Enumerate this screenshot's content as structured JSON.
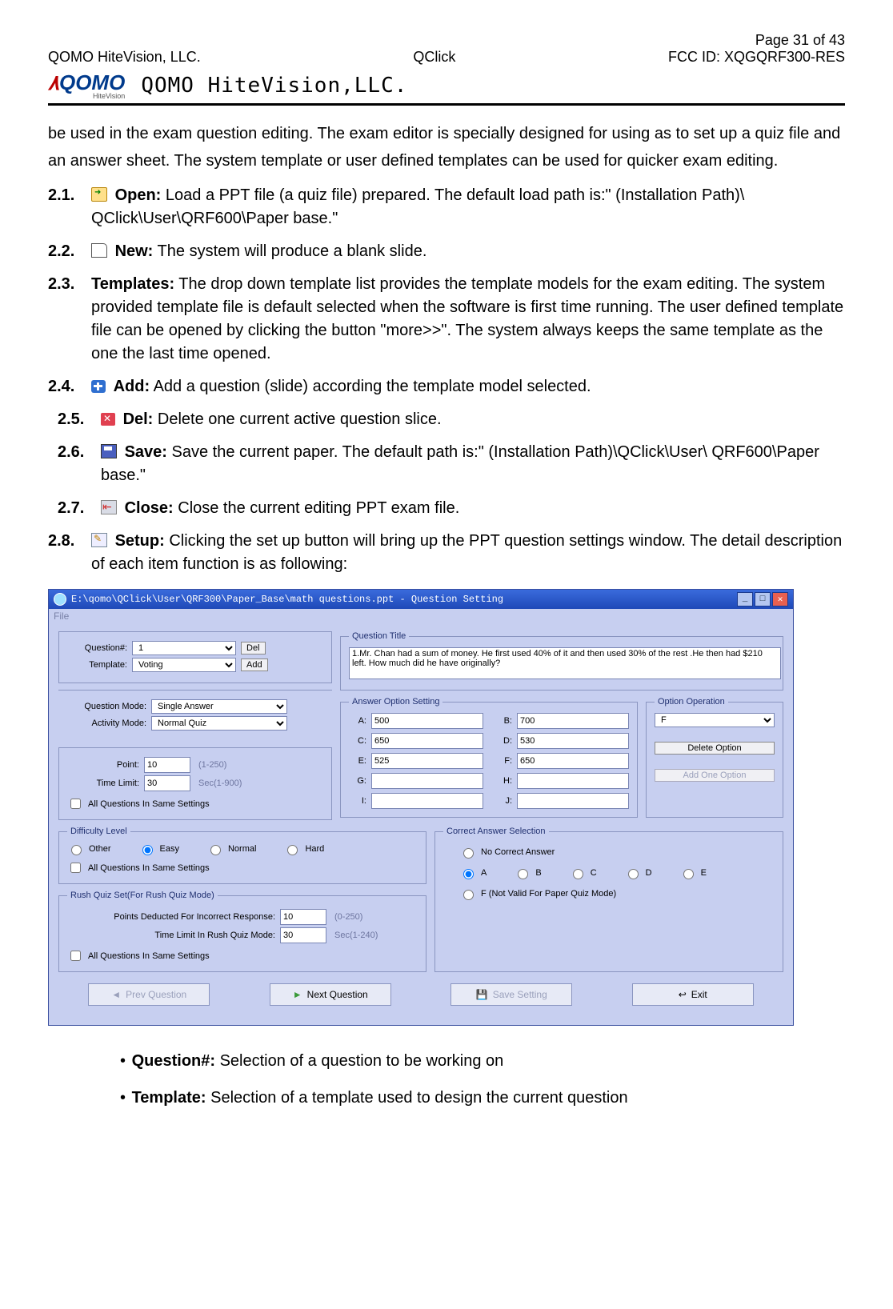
{
  "header": {
    "pageNum": "Page 31 of 43",
    "left": "QOMO HiteVision, LLC.",
    "center": "QClick",
    "right": "FCC ID: XQGQRF300-RES",
    "logo": "QOMO",
    "logoSub": "QOMO HiteVision,LLC."
  },
  "intro": "be used in the exam question editing. The exam editor is specially designed for using as to set up a quiz file and an answer sheet. The system template or user defined templates can be used for quicker exam editing.",
  "items": [
    {
      "num": "2.1.",
      "icon": "open",
      "label": "Open:",
      "text": " Load a PPT file (a quiz file) prepared. The default load path is:\" (Installation Path)\\ QClick\\User\\QRF600\\Paper base.\""
    },
    {
      "num": "2.2.",
      "icon": "new",
      "label": "New:",
      "text": " The system will produce a blank slide."
    },
    {
      "num": "2.3.",
      "icon": "",
      "label": "Templates:",
      "text": " The drop down template list provides the template models for the exam editing. The system provided template file is default selected when the software is first time running. The user defined template file can be opened by clicking the button \"more>>\". The system always keeps the same template as the one the last time opened."
    },
    {
      "num": "2.4.",
      "icon": "add",
      "label": "Add:",
      "text": " Add a question (slide) according the template model selected."
    },
    {
      "num": "2.5.",
      "icon": "del",
      "label": "Del:",
      "text": " Delete one current active question slice."
    },
    {
      "num": "2.6.",
      "icon": "save",
      "label": "Save:",
      "text": " Save the current paper. The default path is:\" (Installation Path)\\QClick\\User\\ QRF600\\Paper base.\""
    },
    {
      "num": "2.7.",
      "icon": "close",
      "label": "Close:",
      "text": " Close the current editing PPT exam file."
    },
    {
      "num": "2.8.",
      "icon": "setup",
      "label": "Setup:",
      "text": " Clicking the set up button will bring up the PPT question settings window. The detail description of each item function is as following:"
    }
  ],
  "win": {
    "title": "E:\\qomo\\QClick\\User\\QRF300\\Paper_Base\\math questions.ppt - Question Setting",
    "menu": "File",
    "groupA": {
      "qnumLabel": "Question#:",
      "qnum": "1",
      "del": "Del",
      "tmplLabel": "Template:",
      "tmpl": "Voting",
      "add": "Add"
    },
    "groupB": {
      "qmodeLabel": "Question Mode:",
      "qmode": "Single Answer",
      "amodeLabel": "Activity Mode:",
      "amode": "Normal Quiz"
    },
    "groupC": {
      "pointLabel": "Point:",
      "point": "10",
      "pointHint": "(1-250)",
      "timeLabel": "Time Limit:",
      "time": "30",
      "timeHint": "Sec(1-900)",
      "same": "All Questions In Same Settings"
    },
    "qt": {
      "legend": "Question Title",
      "text": "1.Mr. Chan had a sum of money. He first used 40% of it and then used 30% of the rest .He then had $210 left. How much did he have originally?"
    },
    "ans": {
      "legend": "Answer Option Setting",
      "A": "500",
      "B": "700",
      "C": "650",
      "D": "530",
      "E": "525",
      "F": "650",
      "G": "",
      "H": "",
      "I": "",
      "J": ""
    },
    "opop": {
      "legend": "Option Operation",
      "sel": "F",
      "delBtn": "Delete Option",
      "addBtn": "Add One Option"
    },
    "diff": {
      "legend": "Difficulty Level",
      "opts": [
        "Other",
        "Easy",
        "Normal",
        "Hard"
      ],
      "selected": "Easy",
      "same": "All Questions In Same Settings"
    },
    "rush": {
      "legend": "Rush Quiz Set(For Rush Quiz Mode)",
      "pdLabel": "Points Deducted For Incorrect Response:",
      "pd": "10",
      "pdHint": "(0-250)",
      "tlLabel": "Time Limit In Rush Quiz Mode:",
      "tl": "30",
      "tlHint": "Sec(1-240)",
      "same": "All Questions In Same Settings"
    },
    "cas": {
      "legend": "Correct Answer Selection",
      "none": "No Correct Answer",
      "opts": [
        "A",
        "B",
        "C",
        "D",
        "E"
      ],
      "optF": "F  (Not Valid For Paper Quiz Mode)",
      "selected": "A"
    },
    "nav": {
      "prev": "Prev Question",
      "next": "Next Question",
      "save": "Save Setting",
      "exit": "Exit"
    }
  },
  "bullets": {
    "q": {
      "label": "Question#:",
      "text": " Selection of a question to be working on"
    },
    "t": {
      "label": "Template:",
      "text": " Selection of a template used to design the current question"
    }
  }
}
